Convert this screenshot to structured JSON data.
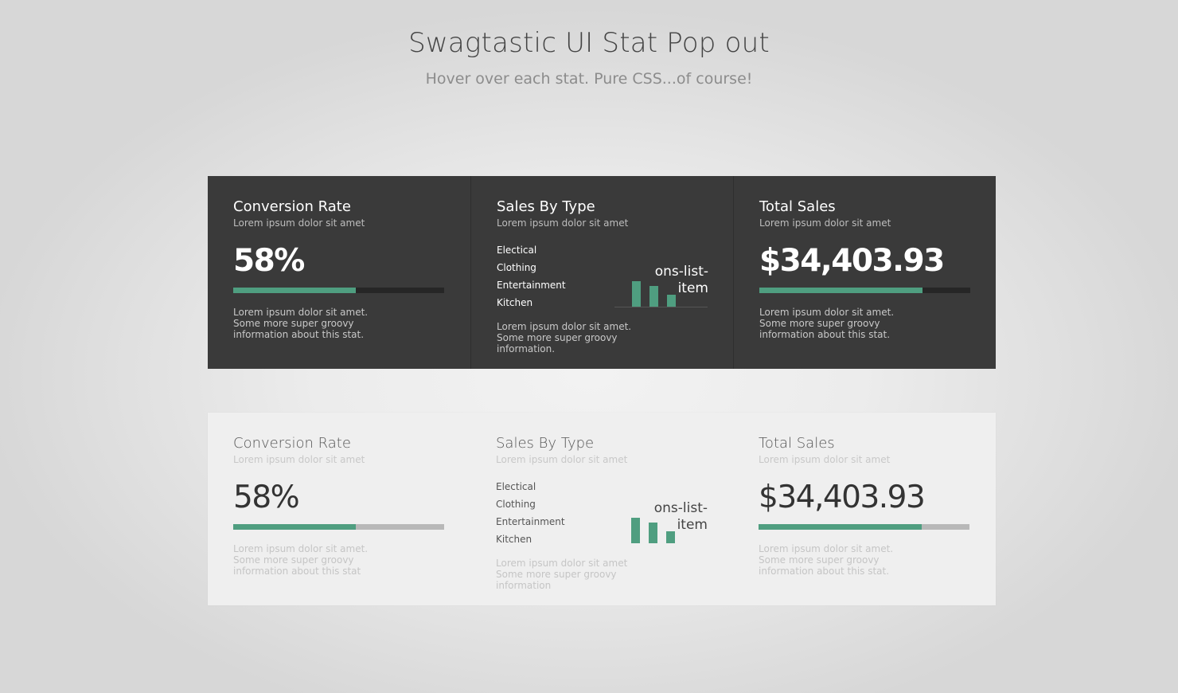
{
  "header": {
    "title": "Swagtastic UI Stat Pop out",
    "subtitle": "Hover over each stat. Pure CSS...of course!"
  },
  "colors": {
    "accent": "#4f9e80",
    "dark_panel": "#3a3a3a",
    "light_panel": "#efefef"
  },
  "dark": {
    "conversion": {
      "title": "Conversion Rate",
      "sub": "Lorem ipsum dolor sit amet",
      "value": "58%",
      "progress": 0.58,
      "desc": "Lorem ipsum dolor sit amet. Some more super groovy information about this stat."
    },
    "sales_type": {
      "title": "Sales By Type",
      "sub": "Lorem ipsum dolor sit amet",
      "types": [
        "Electical",
        "Clothing",
        "Entertainment",
        "Kitchen"
      ],
      "chart_label_1": "ons-list-",
      "chart_label_2": "item",
      "bar_levels": [
        0.62,
        0.5,
        0.28
      ],
      "desc": "Lorem ipsum dolor sit amet. Some more super groovy information."
    },
    "total_sales": {
      "title": "Total Sales",
      "sub": "Lorem ipsum dolor sit amet",
      "value": "$34,403.93",
      "progress": 0.775,
      "desc": "Lorem ipsum dolor sit amet. Some more super groovy information about this stat."
    }
  },
  "light": {
    "conversion": {
      "title": "Conversion Rate",
      "sub": "Lorem ipsum dolor sit amet",
      "value": "58%",
      "progress": 0.58,
      "desc": "Lorem ipsum dolor sit amet. Some more super groovy information about this stat"
    },
    "sales_type": {
      "title": "Sales By Type",
      "sub": "Lorem ipsum dolor sit amet",
      "types": [
        "Electical",
        "Clothing",
        "Entertainment",
        "Kitchen"
      ],
      "chart_label_1": "ons-list-",
      "chart_label_2": "item",
      "bar_levels": [
        0.62,
        0.5,
        0.28
      ],
      "desc": "Lorem ipsum dolor sit amet Some more super groovy information"
    },
    "total_sales": {
      "title": "Total Sales",
      "sub": "Lorem ipsum dolor sit amet",
      "value": "$34,403.93",
      "progress": 0.775,
      "desc": "Lorem ipsum dolor sit amet. Some more super groovy information about this stat."
    }
  }
}
